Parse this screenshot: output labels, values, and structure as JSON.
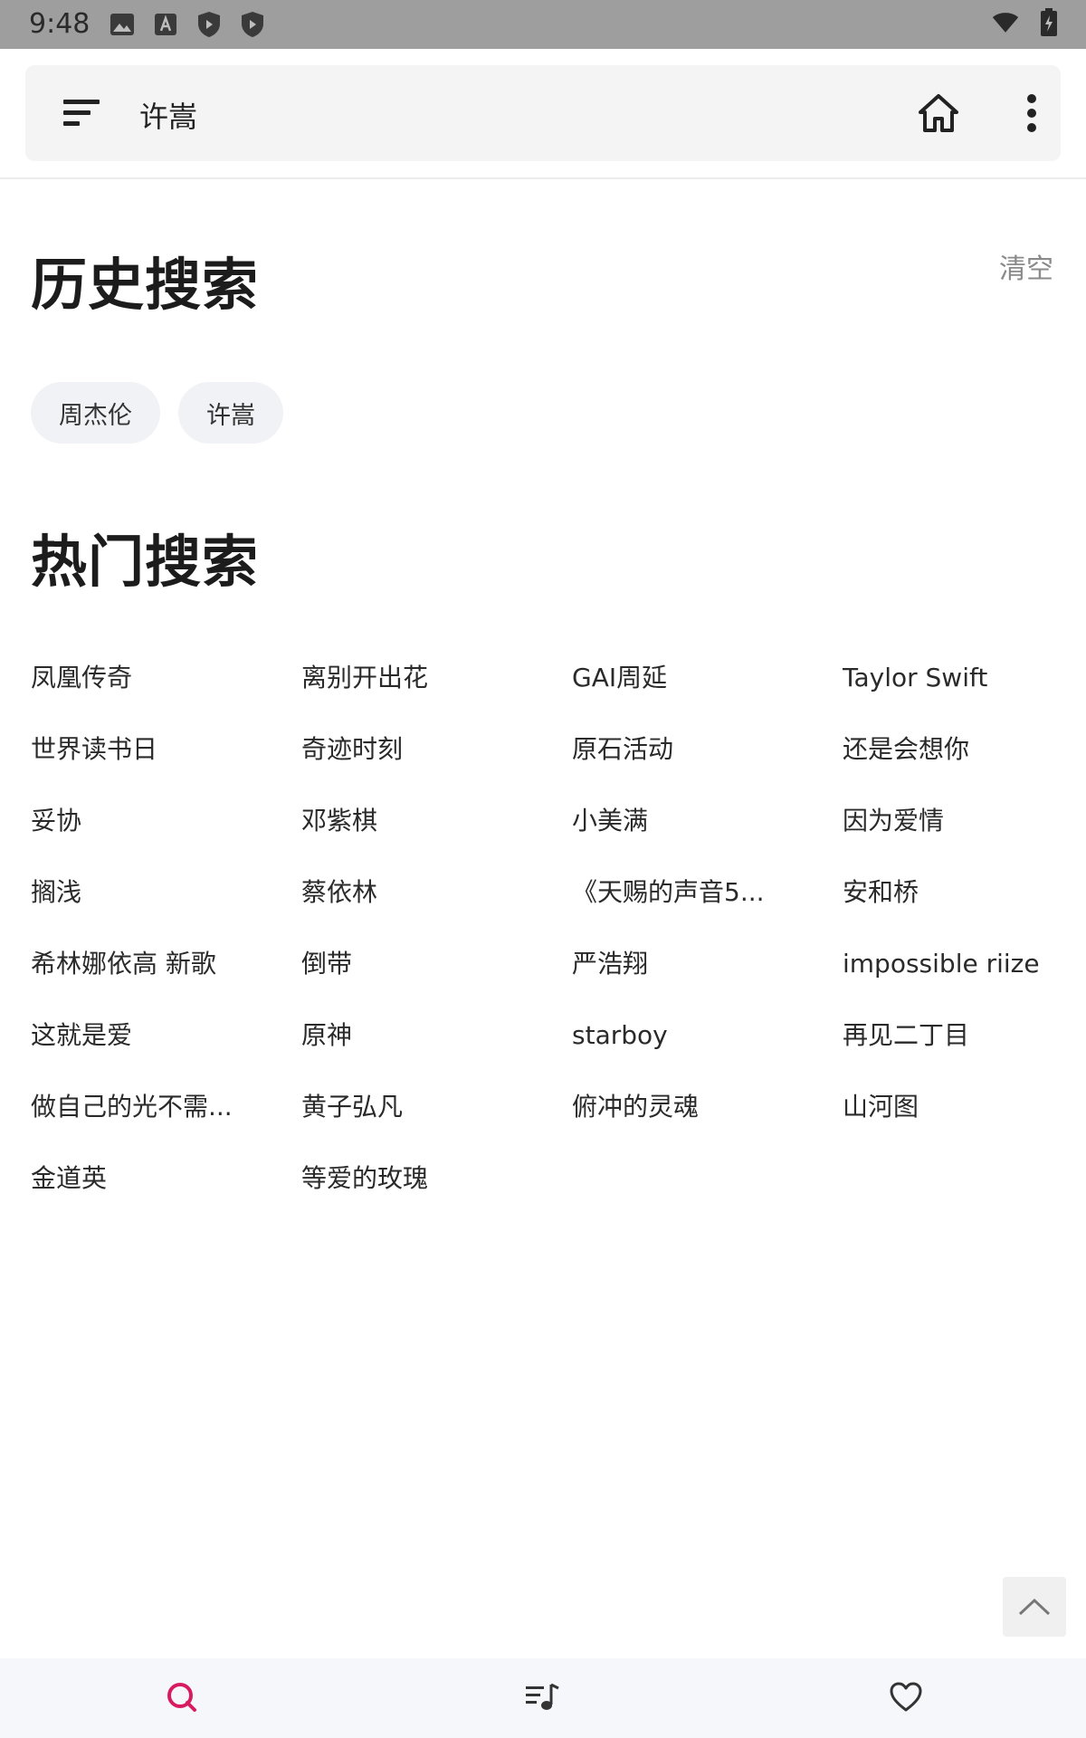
{
  "status_bar": {
    "time": "9:48",
    "left_icons": [
      "image-icon",
      "text-a-icon",
      "shield-icon",
      "shield-icon"
    ],
    "right_icons": [
      "wifi-icon",
      "battery-icon"
    ]
  },
  "appbar": {
    "title": "许嵩",
    "menu_icon": "sort-menu-icon",
    "home_icon": "home-icon",
    "more_icon": "more-vertical-icon"
  },
  "history": {
    "title": "历史搜索",
    "clear_label": "清空",
    "items": [
      "周杰伦",
      "许嵩"
    ]
  },
  "hot": {
    "title": "热门搜索",
    "items": [
      "凤凰传奇",
      "离别开出花",
      "GAI周延",
      "Taylor Swift",
      "世界读书日",
      "奇迹时刻",
      "原石活动",
      "还是会想你",
      "妥协",
      "邓紫棋",
      "小美满",
      "因为爱情",
      "搁浅",
      "蔡依林",
      "《天赐的声音5...",
      "安和桥",
      "希林娜依高 新歌",
      "倒带",
      "严浩翔",
      "impossible riize",
      "这就是爱",
      "原神",
      "starboy",
      "再见二丁目",
      "做自己的光不需...",
      "黄子弘凡",
      "俯冲的灵魂",
      "山河图",
      "金道英",
      "等爱的玫瑰"
    ]
  },
  "bottom_nav": {
    "items": [
      {
        "name": "search",
        "icon": "search-icon",
        "color": "#d81b60",
        "active": true
      },
      {
        "name": "playlist",
        "icon": "playlist-icon",
        "color": "#333333",
        "active": false
      },
      {
        "name": "favorite",
        "icon": "heart-icon",
        "color": "#333333",
        "active": false
      }
    ]
  },
  "colors": {
    "accent": "#d81b60",
    "chip_bg": "#f1f2f6",
    "statusbar_bg": "#9e9e9e"
  }
}
